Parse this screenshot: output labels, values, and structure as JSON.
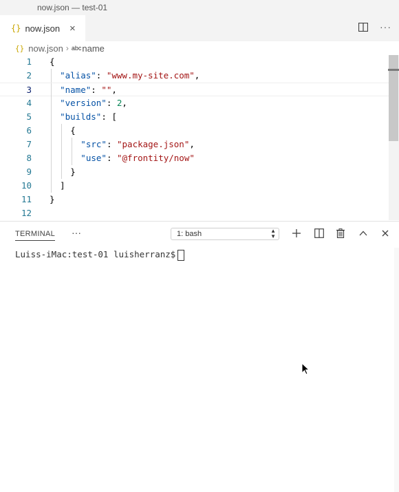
{
  "window": {
    "title": "now.json — test-01"
  },
  "tabs": [
    {
      "label": "now.json",
      "icon": "json-braces-icon",
      "close_glyph": "×"
    }
  ],
  "tab_actions": {
    "split_icon": "split-editor-icon",
    "more_label": "···"
  },
  "breadcrumb": {
    "icon_glyph": "{}",
    "file": "now.json",
    "separator": "›",
    "symbol_tag": "abc",
    "symbol": "name"
  },
  "editor": {
    "active_line": 3,
    "lines": [
      {
        "n": "1",
        "indent": 0,
        "tokens": [
          {
            "t": "{",
            "c": "p"
          }
        ]
      },
      {
        "n": "2",
        "indent": 1,
        "tokens": [
          {
            "t": "\"alias\"",
            "c": "key"
          },
          {
            "t": ": ",
            "c": "p"
          },
          {
            "t": "\"www.my-site.com\"",
            "c": "str"
          },
          {
            "t": ",",
            "c": "p"
          }
        ]
      },
      {
        "n": "3",
        "indent": 1,
        "tokens": [
          {
            "t": "\"name\"",
            "c": "key"
          },
          {
            "t": ": ",
            "c": "p"
          },
          {
            "t": "\"\"",
            "c": "str"
          },
          {
            "t": ",",
            "c": "p"
          }
        ]
      },
      {
        "n": "4",
        "indent": 1,
        "tokens": [
          {
            "t": "\"version\"",
            "c": "key"
          },
          {
            "t": ": ",
            "c": "p"
          },
          {
            "t": "2",
            "c": "num"
          },
          {
            "t": ",",
            "c": "p"
          }
        ]
      },
      {
        "n": "5",
        "indent": 1,
        "tokens": [
          {
            "t": "\"builds\"",
            "c": "key"
          },
          {
            "t": ": [",
            "c": "p"
          }
        ]
      },
      {
        "n": "6",
        "indent": 2,
        "tokens": [
          {
            "t": "{",
            "c": "p"
          }
        ]
      },
      {
        "n": "7",
        "indent": 3,
        "tokens": [
          {
            "t": "\"src\"",
            "c": "key"
          },
          {
            "t": ": ",
            "c": "p"
          },
          {
            "t": "\"package.json\"",
            "c": "str"
          },
          {
            "t": ",",
            "c": "p"
          }
        ]
      },
      {
        "n": "8",
        "indent": 3,
        "tokens": [
          {
            "t": "\"use\"",
            "c": "key"
          },
          {
            "t": ": ",
            "c": "p"
          },
          {
            "t": "\"@frontity/now\"",
            "c": "str"
          }
        ]
      },
      {
        "n": "9",
        "indent": 2,
        "tokens": [
          {
            "t": "}",
            "c": "p"
          }
        ]
      },
      {
        "n": "10",
        "indent": 1,
        "tokens": [
          {
            "t": "]",
            "c": "p"
          }
        ]
      },
      {
        "n": "11",
        "indent": 0,
        "tokens": [
          {
            "t": "}",
            "c": "p"
          }
        ]
      },
      {
        "n": "12",
        "indent": 0,
        "tokens": []
      }
    ]
  },
  "panel": {
    "tab_label": "TERMINAL",
    "more_label": "···",
    "shell_select": "1: bash",
    "actions": [
      "plus-icon",
      "split-terminal-icon",
      "trash-icon",
      "chevron-up-icon",
      "close-icon"
    ]
  },
  "terminal": {
    "prompt": "Luiss-iMac:test-01 luisherranz$"
  },
  "colors": {
    "key": "#0451a5",
    "string": "#a31515",
    "number": "#098658",
    "line_number": "#237893"
  }
}
